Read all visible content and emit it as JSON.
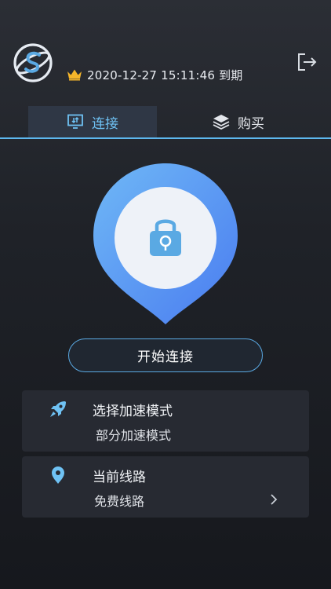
{
  "header": {
    "expiry_text": "2020-12-27 15:11:46 到期",
    "logo_icon": "app-logo-icon",
    "crown_icon": "crown-icon",
    "logout_icon": "logout-icon"
  },
  "tabs": [
    {
      "label": "连接",
      "icon": "connect-monitor-icon",
      "active": true
    },
    {
      "label": "购买",
      "icon": "layers-icon",
      "active": false
    }
  ],
  "main": {
    "status_icon": "lock-icon",
    "connect_button_label": "开始连接"
  },
  "cards": {
    "mode": {
      "title": "选择加速模式",
      "value": "部分加速模式",
      "icon": "rocket-icon"
    },
    "route": {
      "title": "当前线路",
      "value": "免费线路",
      "icon": "location-pin-icon"
    }
  },
  "colors": {
    "accent": "#5db7ee",
    "pin_gradient_start": "#6fb8f6",
    "pin_gradient_end": "#4a7cf0",
    "crown": "#f5b52a",
    "card_bg": "#272a32"
  }
}
